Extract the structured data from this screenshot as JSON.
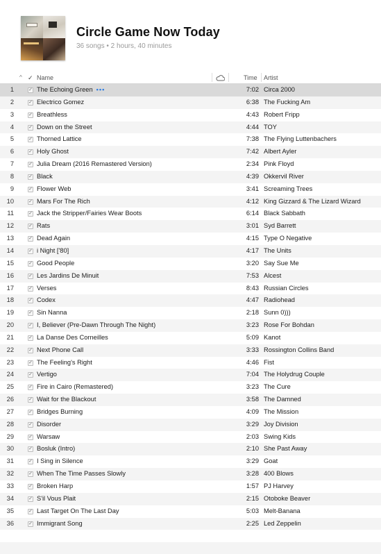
{
  "playlist": {
    "title": "Circle Game Now Today",
    "subtitle": "36 songs • 2 hours, 40 minutes",
    "artwork_icon": "playlist-artwork-collage"
  },
  "columns": {
    "sort_indicator": "^",
    "check": "✓",
    "name": "Name",
    "cloud_icon": "cloud-icon",
    "time": "Time",
    "artist": "Artist"
  },
  "selected_row_more": "•••",
  "tracks": [
    {
      "num": "1",
      "name": "The Echoing Green",
      "time": "7:02",
      "artist": "Circa 2000"
    },
    {
      "num": "2",
      "name": "Electrico Gomez",
      "time": "6:38",
      "artist": "The Fucking Am"
    },
    {
      "num": "3",
      "name": "Breathless",
      "time": "4:43",
      "artist": "Robert Fripp"
    },
    {
      "num": "4",
      "name": "Down on the Street",
      "time": "4:44",
      "artist": "TOY"
    },
    {
      "num": "5",
      "name": "Thorned Lattice",
      "time": "7:38",
      "artist": "The Flying Luttenbachers"
    },
    {
      "num": "6",
      "name": "Holy Ghost",
      "time": "7:42",
      "artist": "Albert Ayler"
    },
    {
      "num": "7",
      "name": "Julia Dream (2016 Remastered Version)",
      "time": "2:34",
      "artist": "Pink Floyd"
    },
    {
      "num": "8",
      "name": "Black",
      "time": "4:39",
      "artist": "Okkervil River"
    },
    {
      "num": "9",
      "name": "Flower Web",
      "time": "3:41",
      "artist": "Screaming Trees"
    },
    {
      "num": "10",
      "name": "Mars For The Rich",
      "time": "4:12",
      "artist": "King Gizzard & The Lizard Wizard"
    },
    {
      "num": "11",
      "name": "Jack the Stripper/Fairies Wear Boots",
      "time": "6:14",
      "artist": "Black Sabbath"
    },
    {
      "num": "12",
      "name": "Rats",
      "time": "3:01",
      "artist": "Syd Barrett"
    },
    {
      "num": "13",
      "name": "Dead Again",
      "time": "4:15",
      "artist": "Type O Negative"
    },
    {
      "num": "14",
      "name": "i Night ['80]",
      "time": "4:17",
      "artist": "The Units"
    },
    {
      "num": "15",
      "name": "Good People",
      "time": "3:20",
      "artist": "Say Sue Me"
    },
    {
      "num": "16",
      "name": "Les Jardins De Minuit",
      "time": "7:53",
      "artist": "Alcest"
    },
    {
      "num": "17",
      "name": "Verses",
      "time": "8:43",
      "artist": "Russian Circles"
    },
    {
      "num": "18",
      "name": "Codex",
      "time": "4:47",
      "artist": "Radiohead"
    },
    {
      "num": "19",
      "name": "Sin Nanna",
      "time": "2:18",
      "artist": "Sunn 0)))"
    },
    {
      "num": "20",
      "name": "I, Believer (Pre-Dawn Through The Night)",
      "time": "3:23",
      "artist": "Rose For Bohdan"
    },
    {
      "num": "21",
      "name": "La Danse Des Corneilles",
      "time": "5:09",
      "artist": "Kanot"
    },
    {
      "num": "22",
      "name": "Next Phone Call",
      "time": "3:33",
      "artist": "Rossington Collins Band"
    },
    {
      "num": "23",
      "name": "The Feeling's Right",
      "time": "4:46",
      "artist": "Fist"
    },
    {
      "num": "24",
      "name": "Vertigo",
      "time": "7:04",
      "artist": "The Holydrug Couple"
    },
    {
      "num": "25",
      "name": "Fire in Cairo (Remastered)",
      "time": "3:23",
      "artist": "The Cure"
    },
    {
      "num": "26",
      "name": "Wait for the Blackout",
      "time": "3:58",
      "artist": "The Damned"
    },
    {
      "num": "27",
      "name": "Bridges Burning",
      "time": "4:09",
      "artist": "The Mission"
    },
    {
      "num": "28",
      "name": "Disorder",
      "time": "3:29",
      "artist": "Joy Division"
    },
    {
      "num": "29",
      "name": "Warsaw",
      "time": "2:03",
      "artist": "Swing Kids"
    },
    {
      "num": "30",
      "name": "Bosluk (Intro)",
      "time": "2:10",
      "artist": "She Past Away"
    },
    {
      "num": "31",
      "name": "I Sing in Silence",
      "time": "3:29",
      "artist": "Goat"
    },
    {
      "num": "32",
      "name": "When The Time Passes Slowly",
      "time": "3:28",
      "artist": "400 Blows"
    },
    {
      "num": "33",
      "name": "Broken Harp",
      "time": "1:57",
      "artist": "PJ Harvey"
    },
    {
      "num": "34",
      "name": "S'il Vous Plait",
      "time": "2:15",
      "artist": "Otoboke Beaver"
    },
    {
      "num": "35",
      "name": "Last Target On The Last Day",
      "time": "5:03",
      "artist": "Melt-Banana"
    },
    {
      "num": "36",
      "name": "Immigrant Song",
      "time": "2:25",
      "artist": "Led Zeppelin"
    }
  ],
  "colors": {
    "selected_row": "#d9d9d9",
    "alt_row": "#f4f4f4",
    "accent_dots": "#2f7de1"
  }
}
